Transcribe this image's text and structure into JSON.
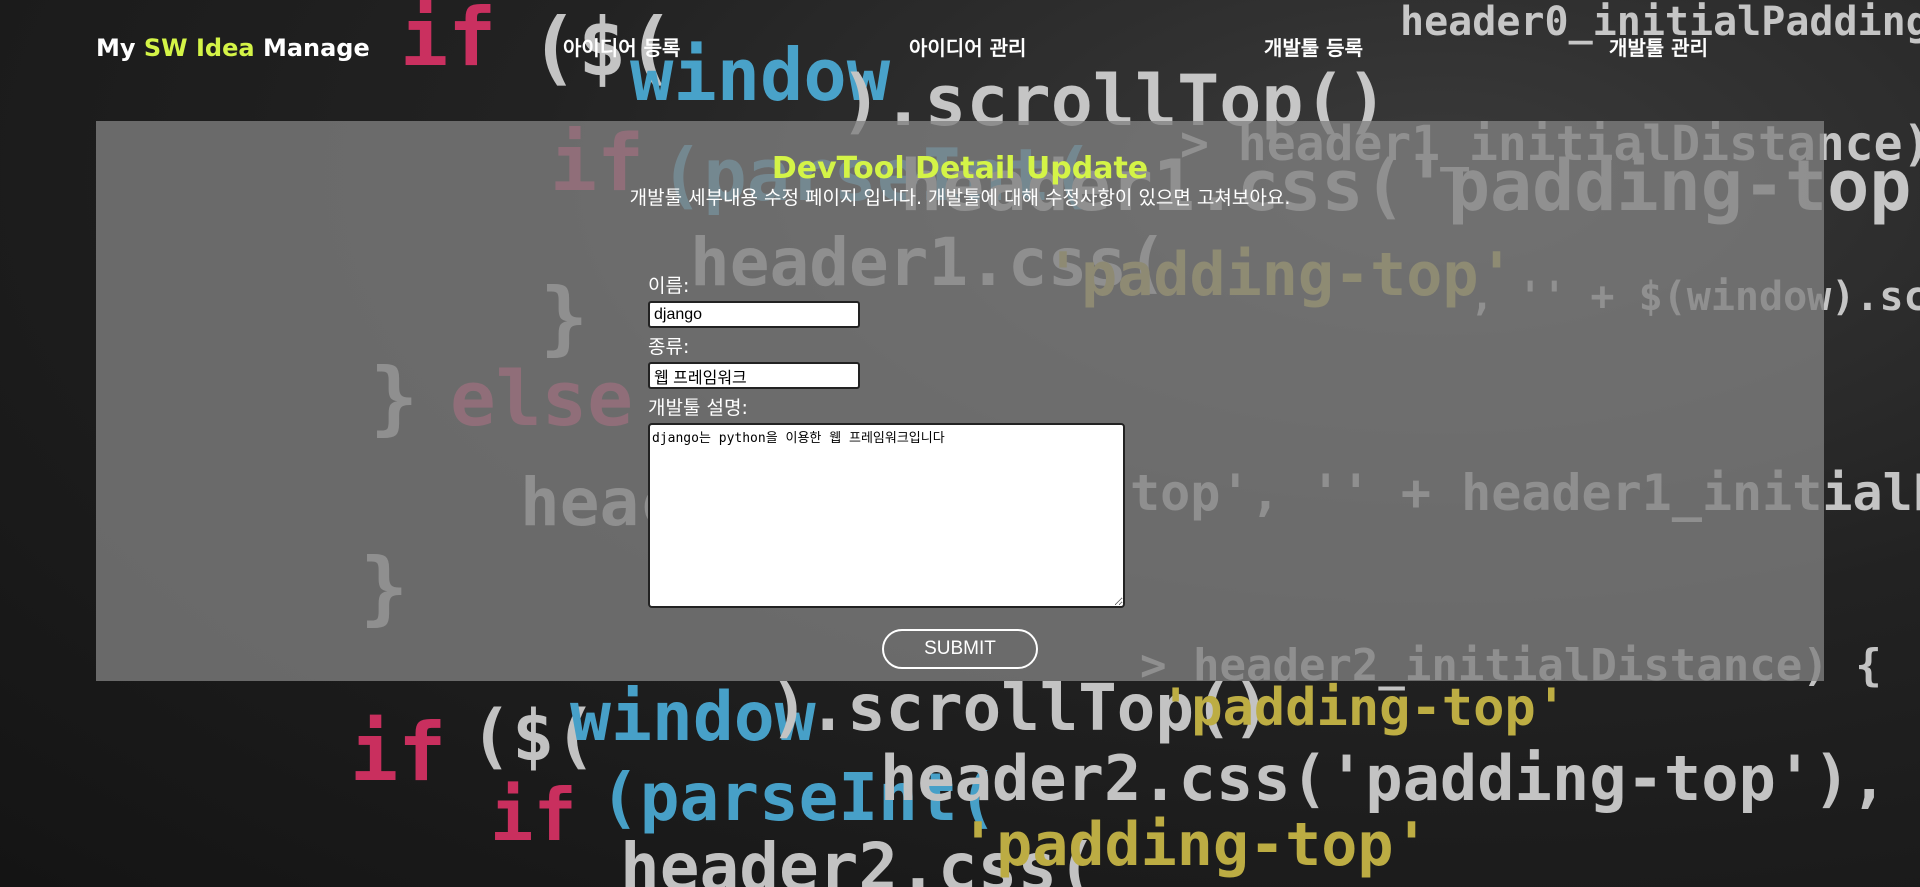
{
  "header": {
    "brand": {
      "prefix": "My ",
      "accent": "SW Idea",
      "suffix": " Manage"
    },
    "nav": [
      {
        "label": "아이디어 등록"
      },
      {
        "label": "아이디어 관리"
      },
      {
        "label": "개발툴 등록"
      },
      {
        "label": "개발툴 관리"
      }
    ]
  },
  "main": {
    "title": "DevTool Detail Update",
    "subtitle": "개발툴 세부내용 수정 페이지 입니다. 개발툴에 대해 수정사항이 있으면 고쳐보아요.",
    "form": {
      "name_label": "이름:",
      "name_value": "django",
      "kind_label": "종류:",
      "kind_value": "웹 프레임워크",
      "desc_label": "개발툴 설명:",
      "desc_value": "django는 python을 이용한 웹 프레임워크입니다",
      "submit_label": "SUBMIT"
    }
  },
  "colors": {
    "accent": "#d4f447",
    "panel": "rgba(128,128,128,0.78)"
  }
}
